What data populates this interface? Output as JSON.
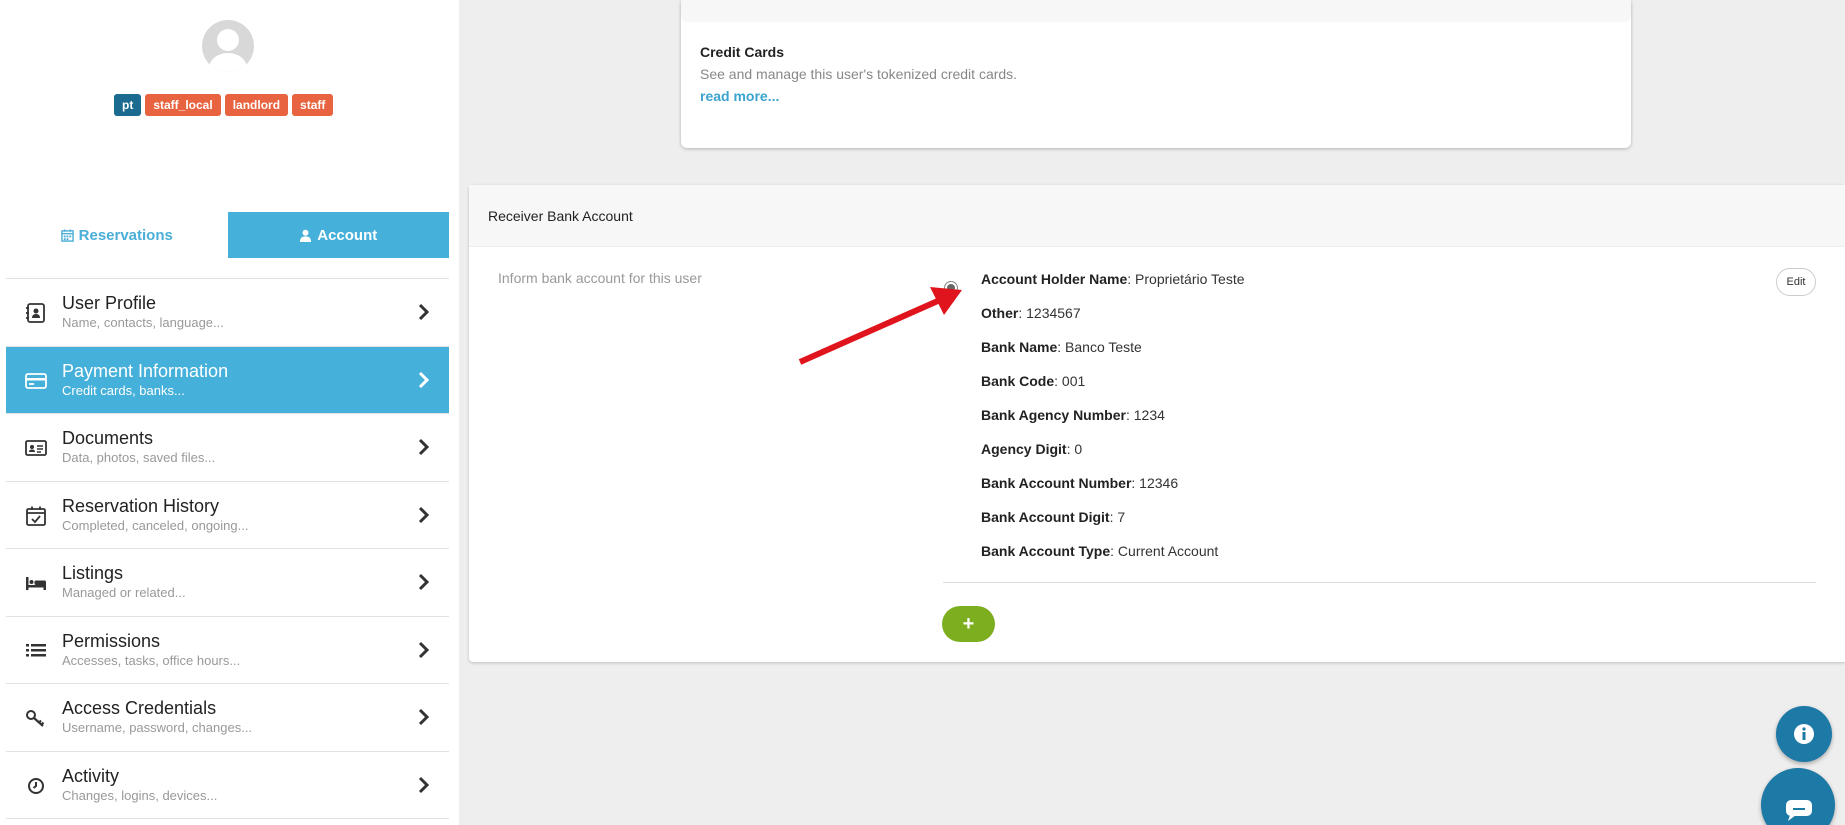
{
  "profile": {
    "badges": [
      {
        "label": "pt",
        "color": "#1b6a90"
      },
      {
        "label": "staff_local",
        "color": "#e8633f"
      },
      {
        "label": "landlord",
        "color": "#e8633f"
      },
      {
        "label": "staff",
        "color": "#e8633f"
      }
    ]
  },
  "tabs": {
    "reservations": "Reservations",
    "account": "Account"
  },
  "menu": [
    {
      "title": "User Profile",
      "sub": "Name, contacts, language...",
      "icon": "contact-card-icon"
    },
    {
      "title": "Payment Information",
      "sub": "Credit cards, banks...",
      "icon": "credit-card-icon"
    },
    {
      "title": "Documents",
      "sub": "Data, photos, saved files...",
      "icon": "id-card-icon"
    },
    {
      "title": "Reservation History",
      "sub": "Completed, canceled, ongoing...",
      "icon": "calendar-check-icon"
    },
    {
      "title": "Listings",
      "sub": "Managed or related...",
      "icon": "bed-icon"
    },
    {
      "title": "Permissions",
      "sub": "Accesses, tasks, office hours...",
      "icon": "list-icon"
    },
    {
      "title": "Access Credentials",
      "sub": "Username, password, changes...",
      "icon": "key-icon"
    },
    {
      "title": "Activity",
      "sub": "Changes, logins, devices...",
      "icon": "clock-icon"
    }
  ],
  "credit_cards": {
    "title": "Credit Cards",
    "description": "See and manage this user's tokenized credit cards.",
    "link": "read more..."
  },
  "receiver_bank": {
    "title": "Receiver Bank Account",
    "hint": "Inform bank account for this user",
    "edit_label": "Edit",
    "add_label": "+",
    "fields": [
      {
        "label": "Account Holder Name",
        "value": "Proprietário Teste"
      },
      {
        "label": "Other",
        "value": "1234567"
      },
      {
        "label": "Bank Name",
        "value": "Banco Teste"
      },
      {
        "label": "Bank Code",
        "value": "001"
      },
      {
        "label": "Bank Agency Number",
        "value": "1234"
      },
      {
        "label": "Agency Digit",
        "value": "0"
      },
      {
        "label": "Bank Account Number",
        "value": "12346"
      },
      {
        "label": "Bank Account Digit",
        "value": "7"
      },
      {
        "label": "Bank Account Type",
        "value": "Current Account"
      }
    ]
  },
  "colors": {
    "accent": "#45b0d9",
    "add_button": "#7cae1f",
    "fab": "#1d79a6",
    "arrow": "#e0141c"
  }
}
